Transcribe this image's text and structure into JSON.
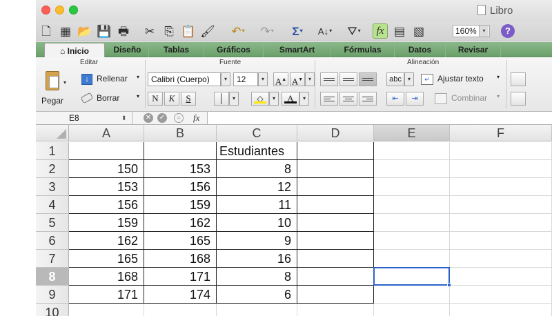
{
  "window": {
    "title": "Libro"
  },
  "toolbar": {
    "zoom": "160%",
    "help": "?"
  },
  "tabs": [
    "Inicio",
    "Diseño",
    "Tablas",
    "Gráficos",
    "SmartArt",
    "Fórmulas",
    "Datos",
    "Revisar"
  ],
  "ribbon": {
    "editar": {
      "label": "Editar",
      "pegar": "Pegar",
      "rellenar": "Rellenar",
      "borrar": "Borrar"
    },
    "fuente": {
      "label": "Fuente",
      "font_name": "Calibri (Cuerpo)",
      "font_size": "12",
      "bold": "N",
      "italic": "K",
      "underline": "S"
    },
    "alineacion": {
      "label": "Alineación",
      "abc": "abc",
      "ajustar": "Ajustar texto",
      "combinar": "Combinar"
    }
  },
  "formula_bar": {
    "name_box": "E8",
    "fx": "fx",
    "content": ""
  },
  "sheet": {
    "columns": [
      "A",
      "B",
      "C",
      "D",
      "E",
      "F"
    ],
    "rows": [
      "1",
      "2",
      "3",
      "4",
      "5",
      "6",
      "7",
      "8",
      "9",
      "10"
    ],
    "selected_cell": "E8",
    "data": [
      [
        "",
        "",
        "Estudiantes"
      ],
      [
        "150",
        "153",
        "8"
      ],
      [
        "153",
        "156",
        "12"
      ],
      [
        "156",
        "159",
        "11"
      ],
      [
        "159",
        "162",
        "10"
      ],
      [
        "162",
        "165",
        "9"
      ],
      [
        "165",
        "168",
        "16"
      ],
      [
        "168",
        "171",
        "8"
      ],
      [
        "171",
        "174",
        "6"
      ],
      [
        "",
        "",
        ""
      ]
    ]
  }
}
